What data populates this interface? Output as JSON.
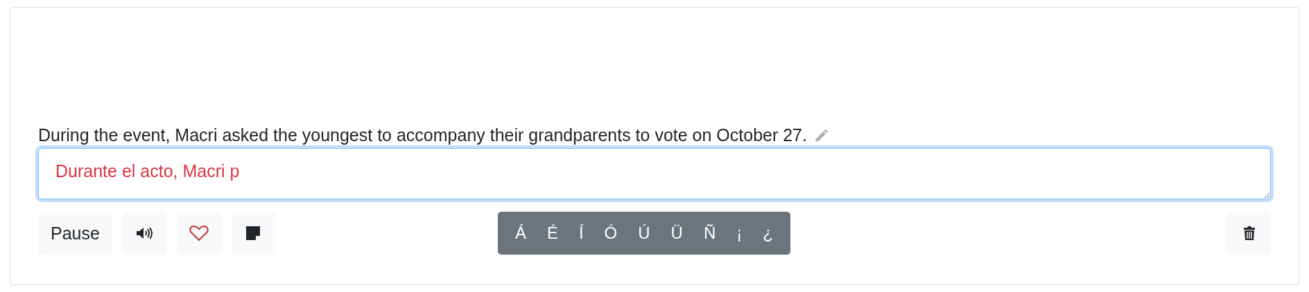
{
  "sentence": "During the event, Macri asked the youngest to accompany their grandparents to vote on October 27.",
  "answer": {
    "value": "Durante el acto, Macri p",
    "incorrect": true
  },
  "pause_button": "Pause",
  "accent_keys": [
    "Á",
    "É",
    "Í",
    "Ó",
    "Ú",
    "Ü",
    "Ñ",
    "¡",
    "¿"
  ]
}
